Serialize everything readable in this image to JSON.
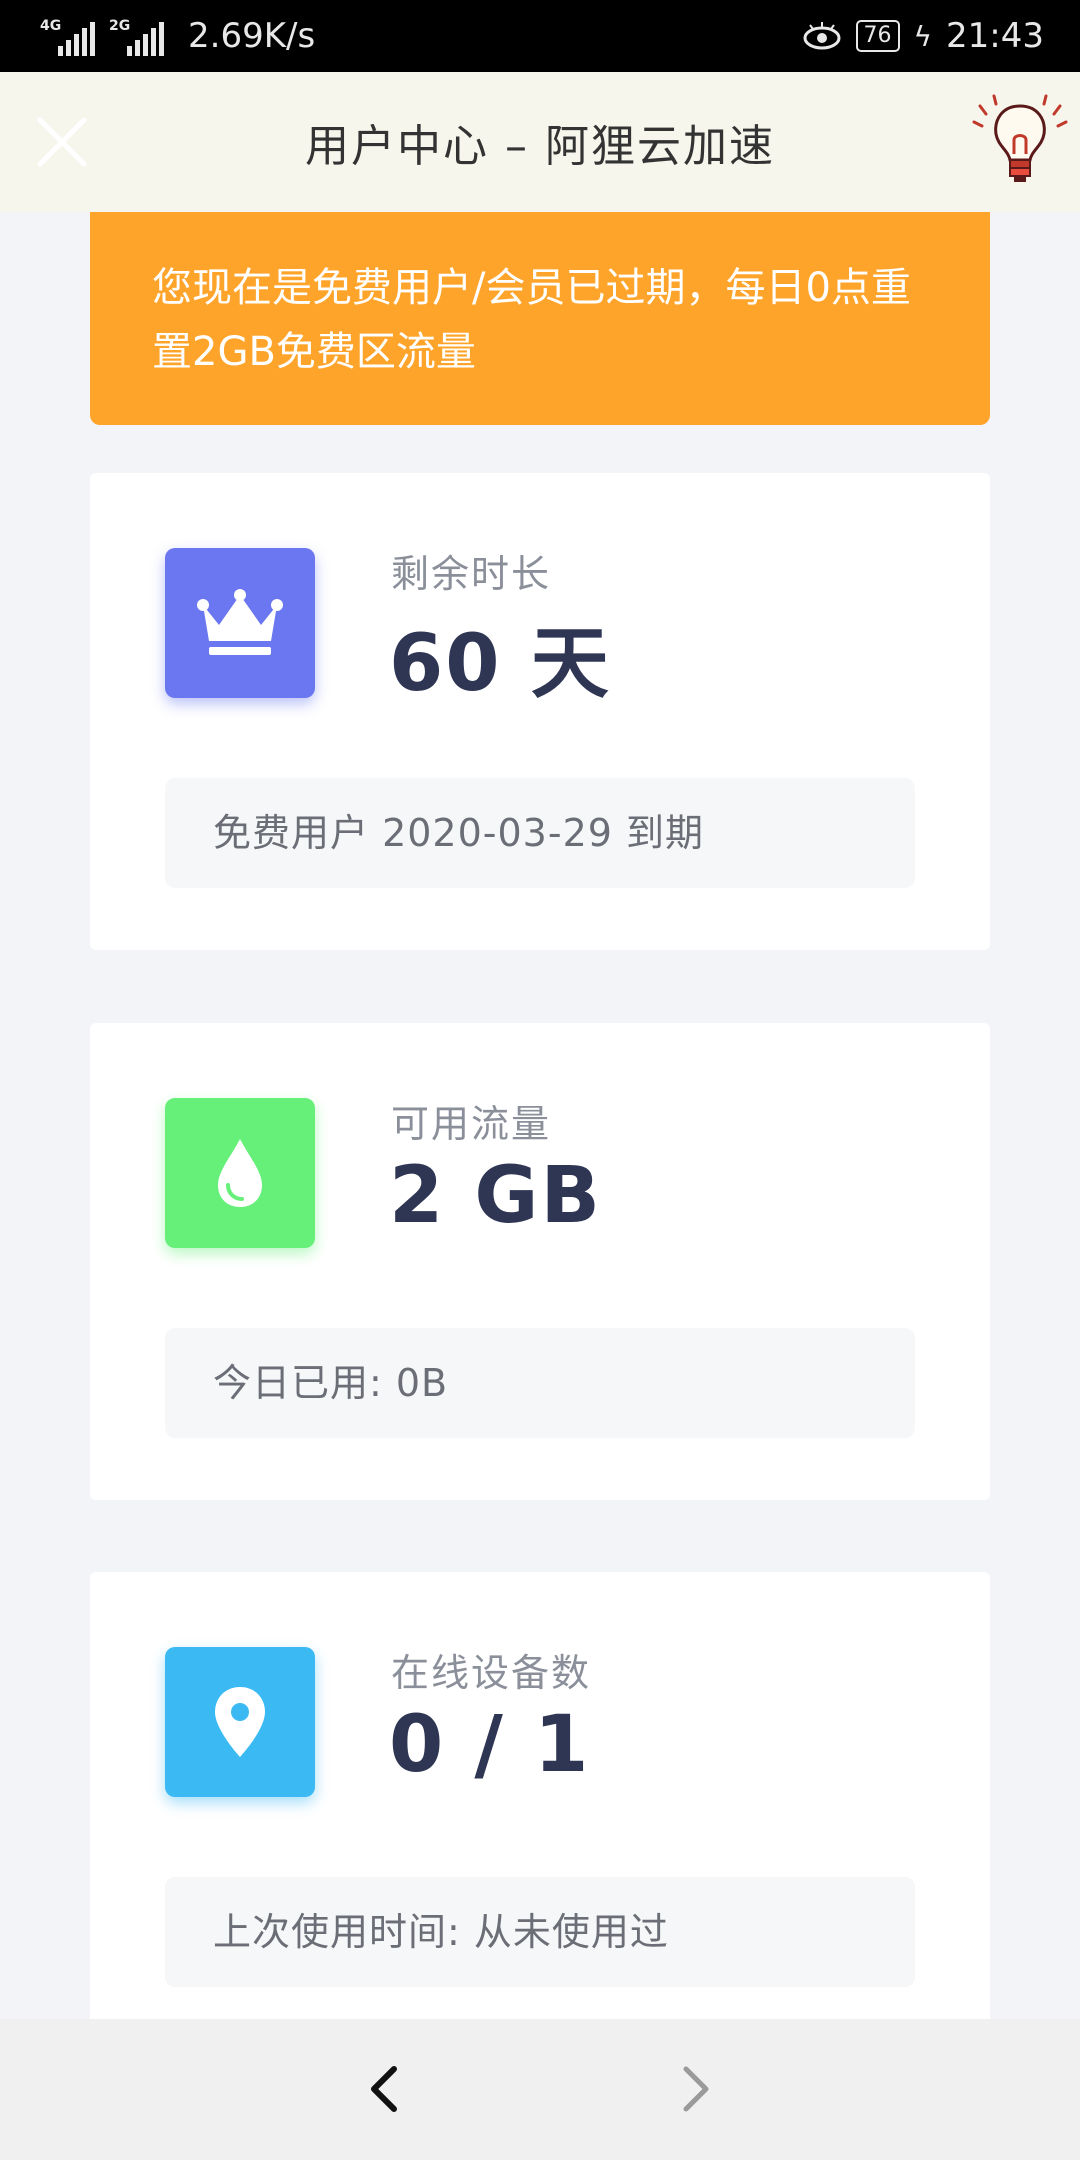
{
  "status_bar": {
    "net1": "4G",
    "net2": "2G",
    "speed": "2.69K/s",
    "battery": "76",
    "time": "21:43"
  },
  "header": {
    "title": "用户中心 – 阿狸云加速",
    "close_icon": "close-icon",
    "bulb_icon": "lightbulb-icon"
  },
  "notice": {
    "text": "您现在是免费用户/会员已过期，每日0点重置2GB免费区流量",
    "color": "#ffa42b"
  },
  "cards": [
    {
      "icon": "crown-icon",
      "icon_color": "#6a77f0",
      "label": "剩余时长",
      "value": "60 天",
      "sub": "免费用户 2020-03-29 到期"
    },
    {
      "icon": "drop-icon",
      "icon_color": "#66f07a",
      "label": "可用流量",
      "value": "2 GB",
      "sub": "今日已用: 0B"
    },
    {
      "icon": "location-pin-icon",
      "icon_color": "#3bb9f3",
      "label": "在线设备数",
      "value": "0 / 1",
      "sub": "上次使用时间: 从未使用过"
    }
  ],
  "bottom_nav": {
    "back_icon": "chevron-left-icon",
    "forward_icon": "chevron-right-icon"
  }
}
